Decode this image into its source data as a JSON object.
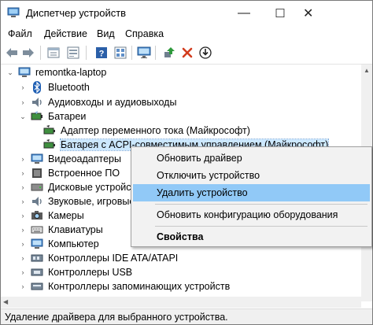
{
  "window": {
    "title": "Диспетчер устройств",
    "minimize_glyph": "—",
    "maximize_glyph": "☐",
    "close_glyph": "✕"
  },
  "menu": [
    "Файл",
    "Действие",
    "Вид",
    "Справка"
  ],
  "toolbar": {
    "icons": [
      "back-arrow-icon",
      "forward-arrow-icon",
      "properties-icon",
      "device-list-icon",
      "help-icon",
      "device-view-icon",
      "monitor-icon",
      "update-driver-icon",
      "uninstall-icon",
      "download-icon"
    ]
  },
  "tree": {
    "root": "remontka-laptop",
    "items": [
      {
        "label": "Bluetooth",
        "icon": "bluetooth-icon"
      },
      {
        "label": "Аудиовходы и аудиовыходы",
        "icon": "audio-icon"
      },
      {
        "label": "Батареи",
        "icon": "battery-icon",
        "expanded": true
      },
      {
        "label": "Адаптер переменного тока (Майкрософт)",
        "icon": "battery-icon",
        "child": true
      },
      {
        "label": "Батарея с ACPI-совместимым управлением (Майкрософт)",
        "icon": "battery-icon",
        "child": true,
        "selected": true
      },
      {
        "label": "Видеоадаптеры",
        "icon": "display-adapter-icon"
      },
      {
        "label": "Встроенное ПО",
        "icon": "firmware-icon"
      },
      {
        "label": "Дисковые устройства",
        "icon": "disk-icon"
      },
      {
        "label": "Звуковые, игровые и видеоустройства",
        "icon": "sound-icon"
      },
      {
        "label": "Камеры",
        "icon": "camera-icon"
      },
      {
        "label": "Клавиатуры",
        "icon": "keyboard-icon"
      },
      {
        "label": "Компьютер",
        "icon": "computer-icon"
      },
      {
        "label": "Контроллеры IDE ATA/ATAPI",
        "icon": "ide-controller-icon"
      },
      {
        "label": "Контроллеры USB",
        "icon": "usb-icon"
      },
      {
        "label": "Контроллеры запоминающих устройств",
        "icon": "storage-controller-icon"
      }
    ]
  },
  "context_menu": {
    "items": [
      "Обновить драйвер",
      "Отключить устройство",
      "Удалить устройство",
      "Обновить конфигурацию оборудования",
      "Свойства"
    ],
    "highlighted": "Удалить устройство"
  },
  "status_bar": "Удаление драйвера для выбранного устройства.",
  "colors": {
    "highlight": "#91c9f7",
    "selection": "#cce8ff",
    "accent": "#0078d7"
  }
}
